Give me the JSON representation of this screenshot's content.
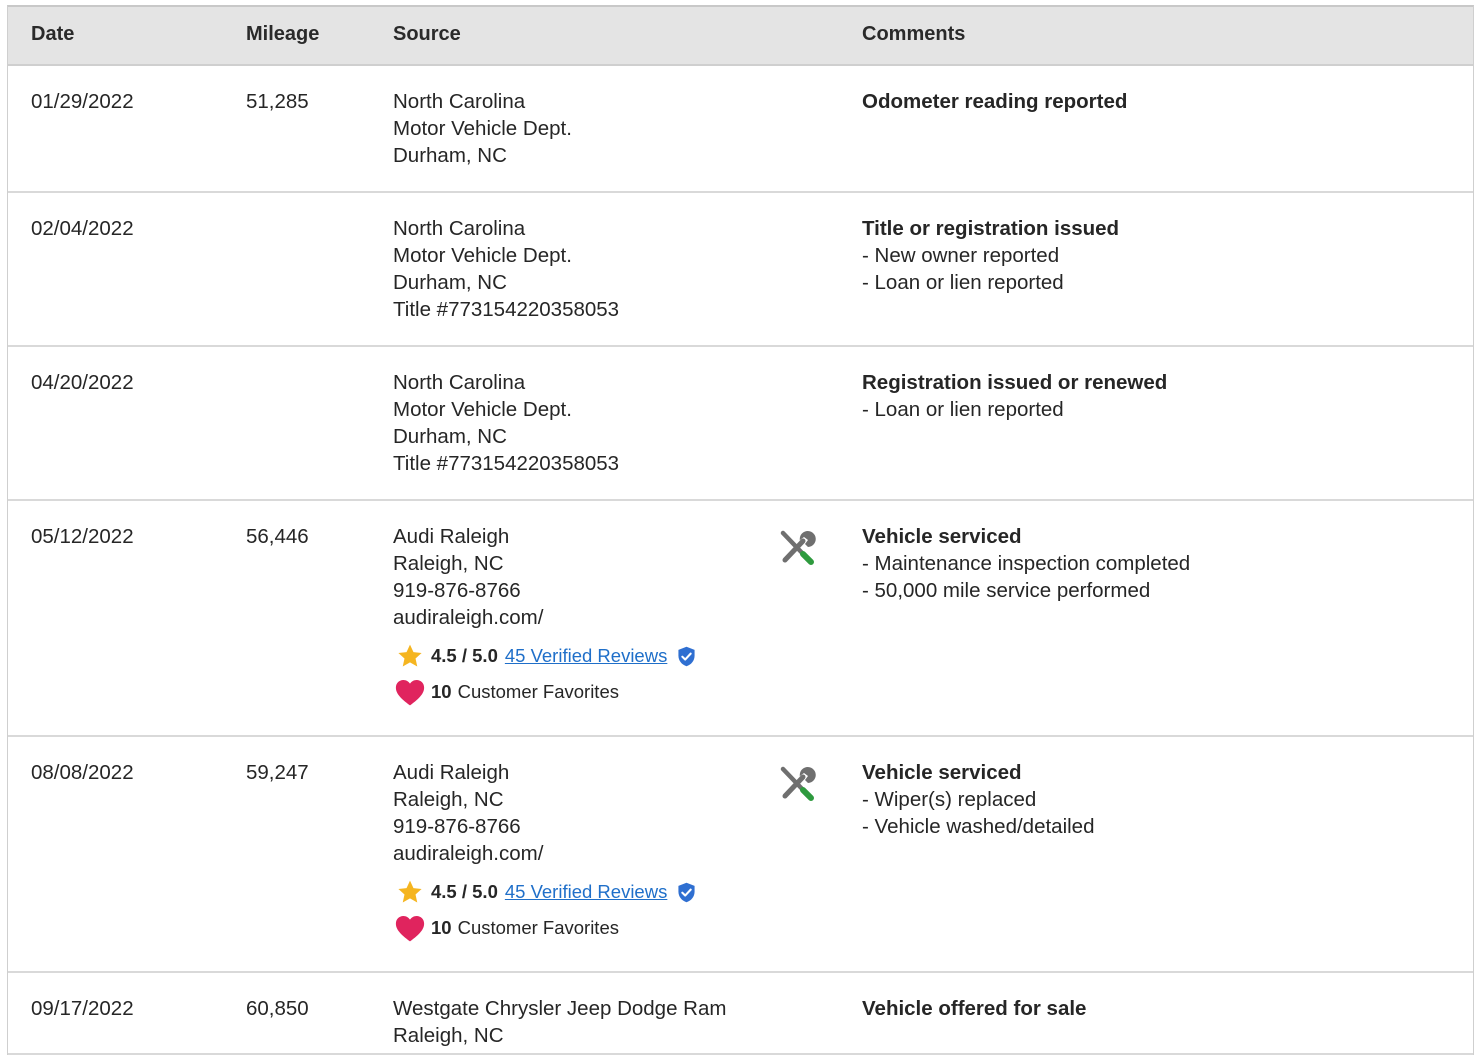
{
  "columns": {
    "date": "Date",
    "mileage": "Mileage",
    "source": "Source",
    "comments": "Comments"
  },
  "rows": [
    {
      "date": "01/29/2022",
      "mileage": "51,285",
      "source": [
        "North Carolina",
        "Motor Vehicle Dept.",
        "Durham, NC"
      ],
      "comment_title": "Odometer reading reported",
      "comment_items": []
    },
    {
      "date": "02/04/2022",
      "mileage": "",
      "source": [
        "North Carolina",
        "Motor Vehicle Dept.",
        "Durham, NC",
        "Title #773154220358053"
      ],
      "comment_title": "Title or registration issued",
      "comment_items": [
        "New owner reported",
        "Loan or lien reported"
      ]
    },
    {
      "date": "04/20/2022",
      "mileage": "",
      "source": [
        "North Carolina",
        "Motor Vehicle Dept.",
        "Durham, NC",
        "Title #773154220358053"
      ],
      "comment_title": "Registration issued or renewed",
      "comment_items": [
        "Loan or lien reported"
      ]
    },
    {
      "date": "05/12/2022",
      "mileage": "56,446",
      "source": [
        "Audi Raleigh",
        "Raleigh, NC",
        "919-876-8766",
        "audiraleigh.com/"
      ],
      "service_icon": "wrench-screwdriver-icon",
      "rating": "4.5 / 5.0",
      "reviews": "45 Verified Reviews",
      "favorites_count": "10",
      "favorites_label": "Customer Favorites",
      "comment_title": "Vehicle serviced",
      "comment_items": [
        "Maintenance inspection completed",
        "50,000 mile service performed"
      ]
    },
    {
      "date": "08/08/2022",
      "mileage": "59,247",
      "source": [
        "Audi Raleigh",
        "Raleigh, NC",
        "919-876-8766",
        "audiraleigh.com/"
      ],
      "service_icon": "wrench-screwdriver-icon",
      "rating": "4.5 / 5.0",
      "reviews": "45 Verified Reviews",
      "favorites_count": "10",
      "favorites_label": "Customer Favorites",
      "comment_title": "Vehicle serviced",
      "comment_items": [
        "Wiper(s) replaced",
        "Vehicle washed/detailed"
      ]
    },
    {
      "date": "09/17/2022",
      "mileage": "60,850",
      "source": [
        "Westgate Chrysler Jeep Dodge Ram",
        "Raleigh, NC"
      ],
      "comment_title": "Vehicle offered for sale",
      "comment_items": []
    }
  ],
  "colors": {
    "header_bg": "#e4e4e4",
    "link": "#1f6fc9",
    "star": "#f5b520",
    "heart": "#e0245e",
    "verified": "#2f6fd1",
    "tool_gray": "#6f6f6f",
    "tool_green": "#2e9a3e"
  }
}
